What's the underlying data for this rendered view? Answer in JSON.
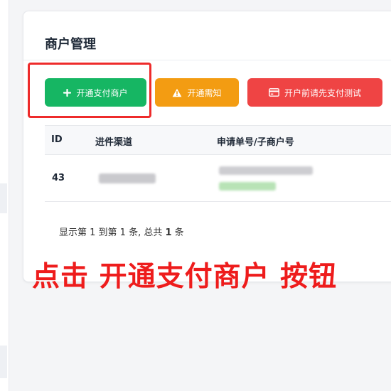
{
  "card": {
    "title": "商户管理"
  },
  "toolbar": {
    "open_label": "开通支付商户",
    "notice_label": "开通需知",
    "test_label": "开户前请先支付测试"
  },
  "table": {
    "headers": [
      "ID",
      "进件渠道",
      "申请单号/子商户号"
    ],
    "rows": [
      {
        "id": "43"
      }
    ]
  },
  "pager": {
    "prefix": "显示第 1 到第 1 条, 总共 ",
    "total": "1",
    "suffix": " 条"
  },
  "annotation": {
    "text": "点击 开通支付商户 按钮"
  },
  "colors": {
    "open": "#16b663",
    "notice": "#f39c12",
    "test": "#ef4444",
    "highlight": "#ee2b2b"
  }
}
